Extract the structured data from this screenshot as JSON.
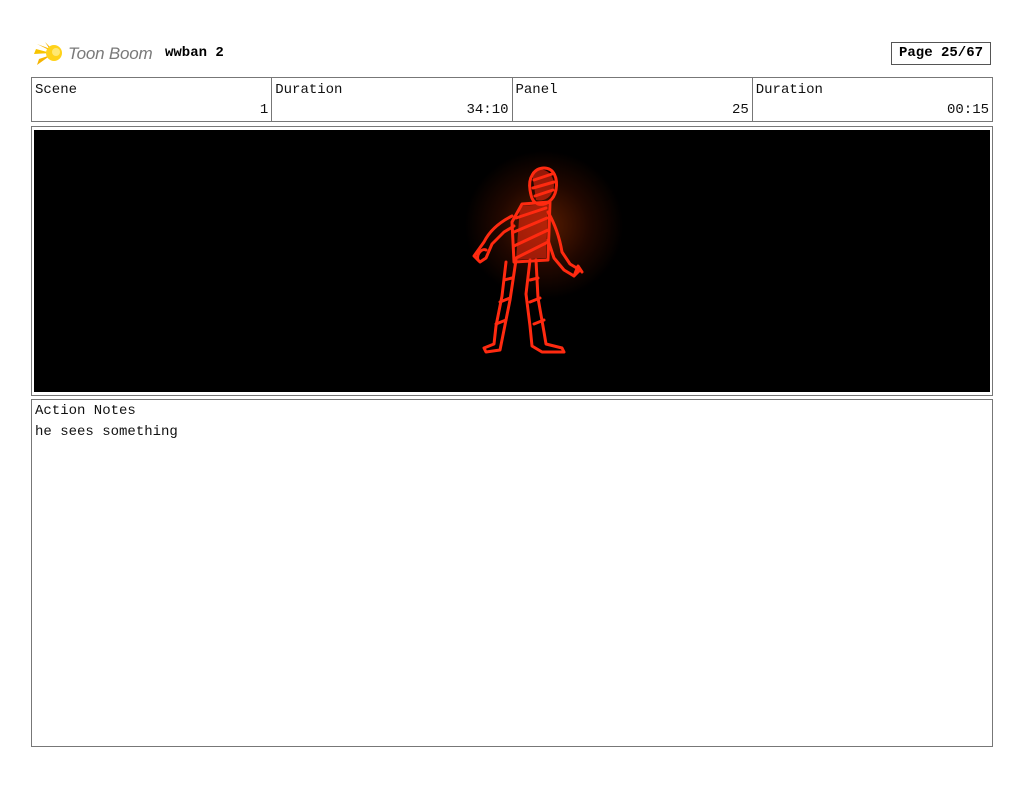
{
  "header": {
    "logo_text": "Toon Boom",
    "logo_icon": "toon-boom-star-icon",
    "project_title": "wwban 2",
    "page_label": "Page 25/67"
  },
  "info": {
    "scene_label": "Scene",
    "scene_value": "1",
    "scene_duration_label": "Duration",
    "scene_duration_value": "34:10",
    "panel_label": "Panel",
    "panel_value": "25",
    "panel_duration_label": "Duration",
    "panel_duration_value": "00:15"
  },
  "panel": {
    "background_color": "#000000",
    "figure_color": "#ff2a10"
  },
  "notes": {
    "label": "Action Notes",
    "text": "he sees something"
  }
}
